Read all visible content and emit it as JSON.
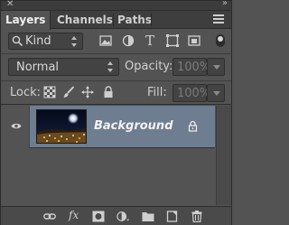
{
  "panel": {
    "tabs": [
      {
        "label": "Layers",
        "active": true
      },
      {
        "label": "Channels",
        "active": false
      },
      {
        "label": "Paths",
        "active": false
      }
    ]
  },
  "filter": {
    "kind_label": "Kind",
    "icons": [
      "image-filter-icon",
      "adjustment-filter-icon",
      "type-filter-icon",
      "shape-filter-icon",
      "smart-object-filter-icon"
    ],
    "type_glyph": "T"
  },
  "blend": {
    "mode": "Normal",
    "opacity_label": "Opacity:",
    "opacity_value": "100%",
    "lock_label": "Lock:",
    "fill_label": "Fill:",
    "fill_value": "100%"
  },
  "layers": [
    {
      "name": "Background",
      "visible": true,
      "locked": true,
      "selected": true
    }
  ],
  "bottom_toolbar": {
    "fx_label": "fx"
  },
  "colors": {
    "panel_bg": "#535353",
    "selected_layer": "#6e7d8f",
    "tab_bar": "#3e3e3e"
  }
}
